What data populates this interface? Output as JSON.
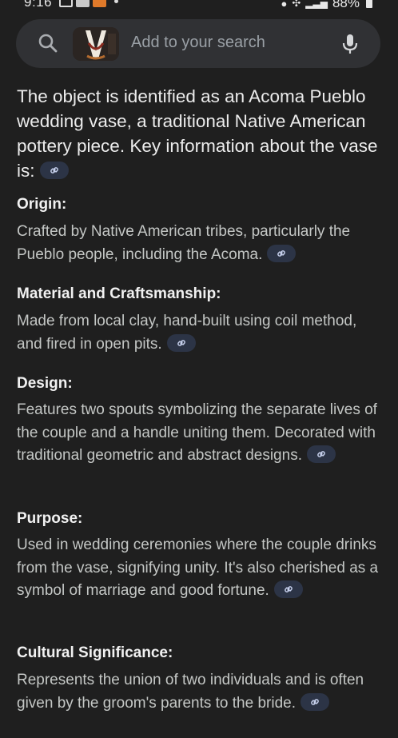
{
  "status_bar": {
    "time": "9:16",
    "battery": "88%"
  },
  "search": {
    "placeholder": "Add to your search"
  },
  "intro": "The object is identified as an Acoma Pueblo wedding vase, a traditional Native American pottery piece. Key information about the vase is:",
  "sections": [
    {
      "heading": "Origin:",
      "text": "Crafted by Native American tribes, particularly the Pueblo people, including the Acoma."
    },
    {
      "heading": "Material and Craftsmanship:",
      "text": "Made from local clay, hand-built using coil method, and fired in open pits."
    },
    {
      "heading": "Design:",
      "text": "Features two spouts symbolizing the separate lives of the couple and a handle uniting them. Decorated with traditional geometric and abstract designs."
    },
    {
      "heading": "Purpose:",
      "text": "Used in wedding ceremonies where the couple drinks from the vase, signifying unity. It's also cherished as a symbol of marriage and good fortune."
    },
    {
      "heading": "Cultural Significance:",
      "text": "Represents the union of two individuals and is often given by the groom's parents to the bride."
    }
  ],
  "icons": {
    "search": "search-icon",
    "mic": "mic-icon",
    "link": "link-icon"
  },
  "colors": {
    "background": "#1f1f1f",
    "search_bar": "#303134",
    "link_chip": "#2c3446"
  }
}
